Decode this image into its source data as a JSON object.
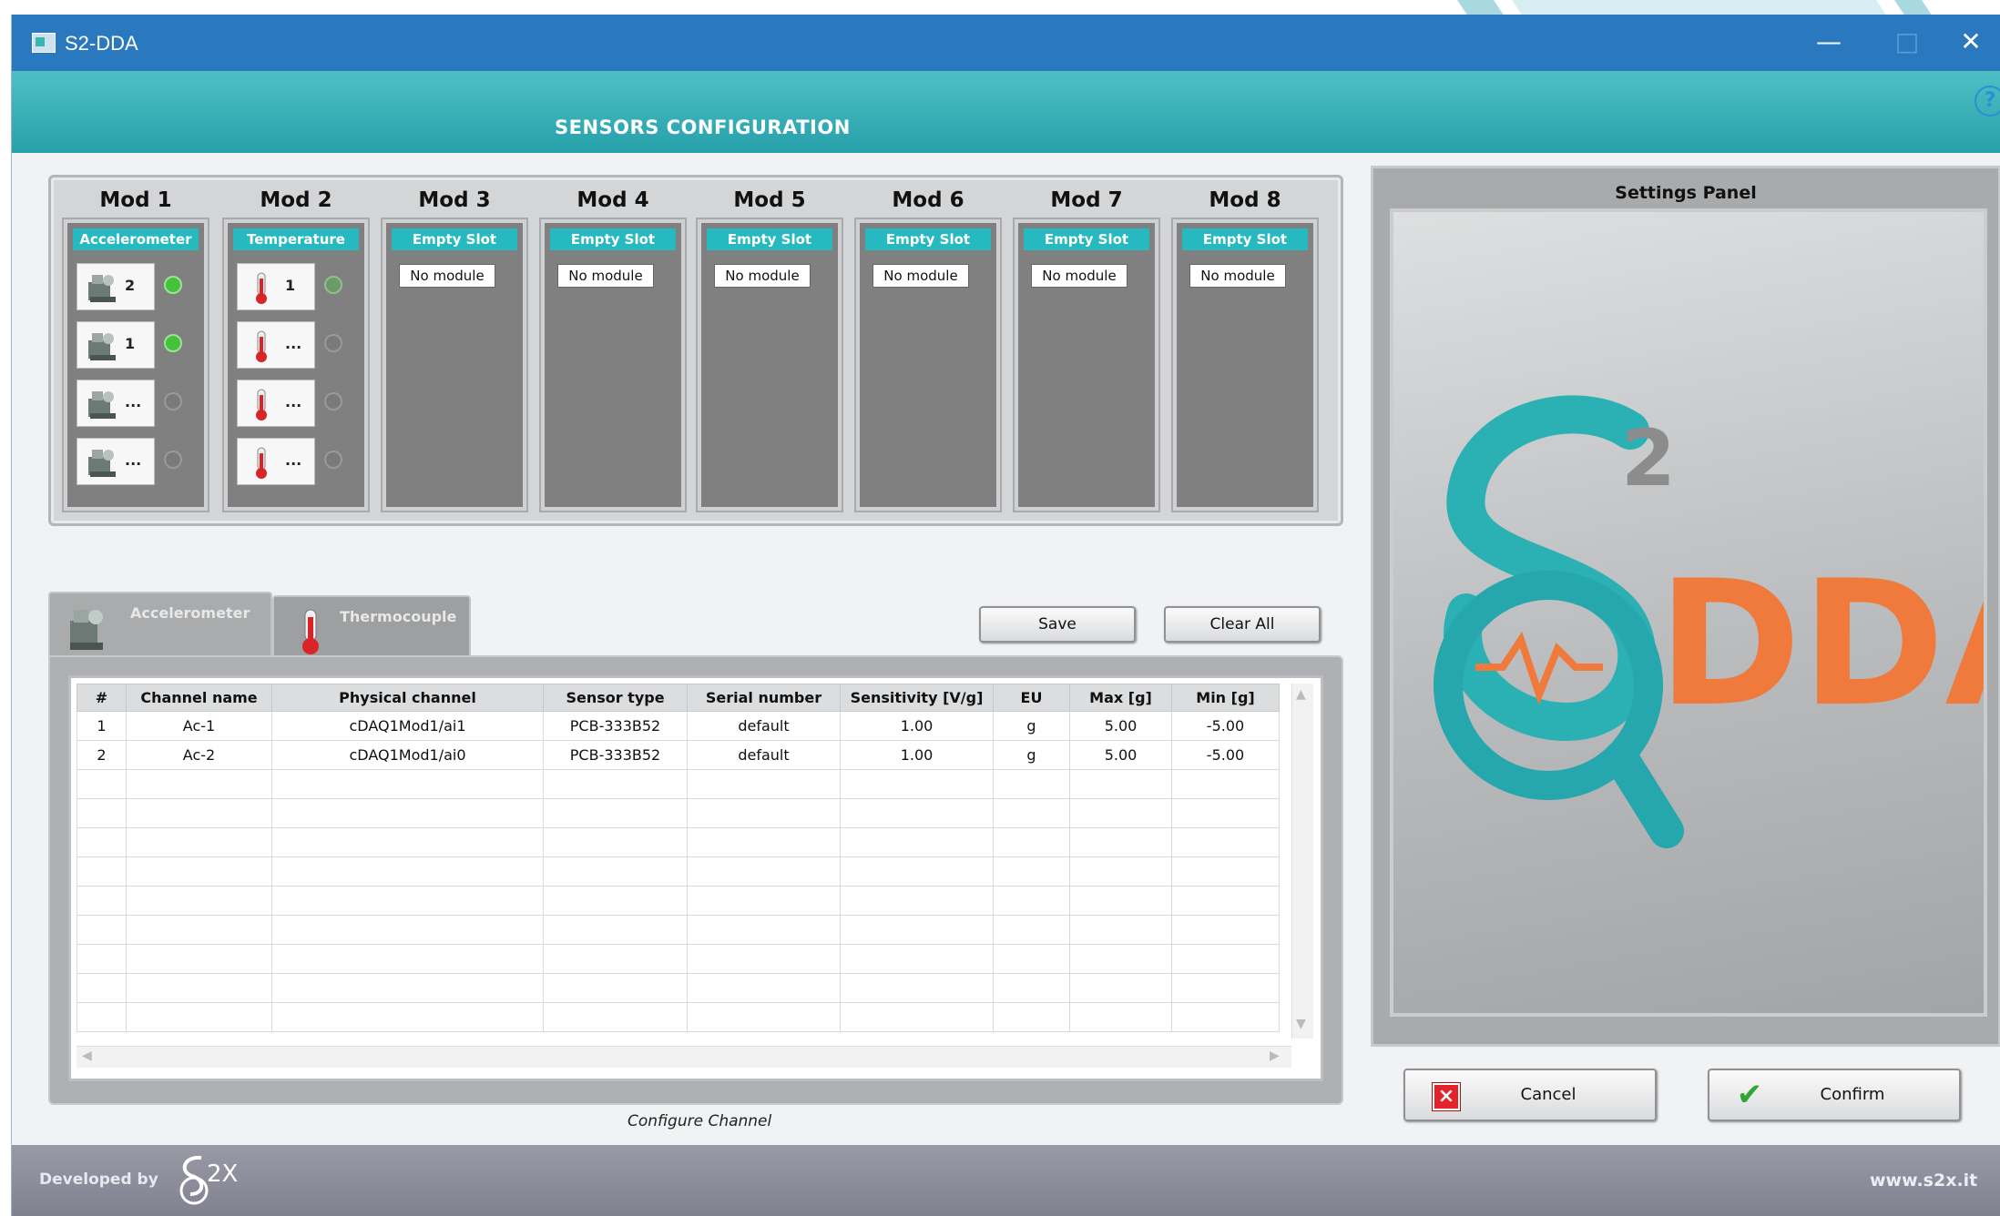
{
  "window": {
    "title": "S2-DDA"
  },
  "window_controls": {
    "minimize": "—",
    "maximize": "□",
    "close": "✕"
  },
  "header": {
    "heading": "SENSORS  CONFIGURATION",
    "help": "?"
  },
  "modules": [
    {
      "title": "Mod 1",
      "slot": "Accelerometer",
      "status": "",
      "channels": [
        "2",
        "1",
        "...",
        "..."
      ],
      "leds": [
        true,
        true,
        false,
        false
      ],
      "icon": "accelerometer-icon"
    },
    {
      "title": "Mod 2",
      "slot": "Temperature",
      "status": "",
      "channels": [
        "1",
        "...",
        "...",
        "..."
      ],
      "leds": [
        false,
        false,
        false,
        false
      ],
      "icon": "thermometer-icon"
    },
    {
      "title": "Mod 3",
      "slot": "Empty Slot",
      "status": "No module"
    },
    {
      "title": "Mod 4",
      "slot": "Empty Slot",
      "status": "No module"
    },
    {
      "title": "Mod 5",
      "slot": "Empty Slot",
      "status": "No module"
    },
    {
      "title": "Mod 6",
      "slot": "Empty Slot",
      "status": "No module"
    },
    {
      "title": "Mod 7",
      "slot": "Empty Slot",
      "status": "No module"
    },
    {
      "title": "Mod 8",
      "slot": "Empty Slot",
      "status": "No module"
    }
  ],
  "tabs": {
    "accelerometer": "Accelerometer",
    "thermocouple": "Thermocouple"
  },
  "actions": {
    "save": "Save",
    "clear_all": "Clear All",
    "cancel": "Cancel",
    "confirm": "Confirm"
  },
  "table": {
    "headers": [
      "#",
      "Channel name",
      "Physical channel",
      "Sensor type",
      "Serial number",
      "Sensitivity [V/g]",
      "EU",
      "Max [g]",
      "Min [g]"
    ],
    "rows": [
      [
        "1",
        "Ac-1",
        "cDAQ1Mod1/ai1",
        "PCB-333B52",
        "default",
        "1.00",
        "g",
        "5.00",
        "-5.00"
      ],
      [
        "2",
        "Ac-2",
        "cDAQ1Mod1/ai0",
        "PCB-333B52",
        "default",
        "1.00",
        "g",
        "5.00",
        "-5.00"
      ]
    ]
  },
  "configure_label": "Configure Channel",
  "settings_panel": {
    "title": "Settings Panel",
    "logo_superscript": "2",
    "logo_text": "DDA"
  },
  "footer": {
    "developed_by": "Developed by",
    "brand": "2X",
    "website": "www.s2x.it"
  },
  "colors": {
    "titlebar": "#2a79bf",
    "accent_teal": "#27b9c0",
    "logo_orange": "#ef7a3c",
    "led_on": "#46c23a"
  }
}
